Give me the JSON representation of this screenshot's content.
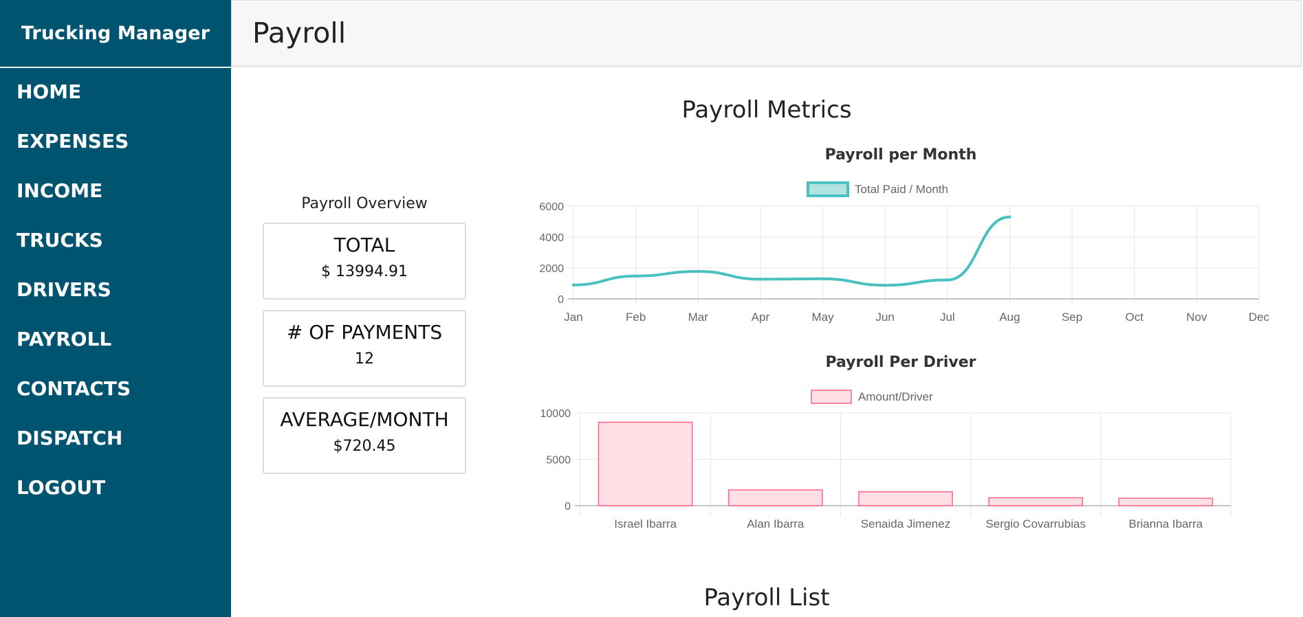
{
  "app": {
    "brand": "Trucking Manager"
  },
  "nav": {
    "items": [
      {
        "label": "HOME"
      },
      {
        "label": "EXPENSES"
      },
      {
        "label": "INCOME"
      },
      {
        "label": "TRUCKS"
      },
      {
        "label": "DRIVERS"
      },
      {
        "label": "PAYROLL"
      },
      {
        "label": "CONTACTS"
      },
      {
        "label": "DISPATCH"
      },
      {
        "label": "LOGOUT"
      }
    ]
  },
  "header": {
    "title": "Payroll"
  },
  "metrics": {
    "title": "Payroll Metrics"
  },
  "overview": {
    "title": "Payroll Overview",
    "cards": [
      {
        "label": "TOTAL",
        "value": "$ 13994.91"
      },
      {
        "label": "# OF PAYMENTS",
        "value": "12"
      },
      {
        "label": "AVERAGE/MONTH",
        "value": "$720.45"
      }
    ]
  },
  "list": {
    "title": "Payroll List"
  },
  "chart_data": [
    {
      "type": "line",
      "title": "Payroll per Month",
      "categories": [
        "Jan",
        "Feb",
        "Mar",
        "Apr",
        "May",
        "Jun",
        "Jul",
        "Aug",
        "Sep",
        "Oct",
        "Nov",
        "Dec"
      ],
      "series": [
        {
          "name": "Total Paid / Month",
          "values": [
            900,
            1480,
            1780,
            1270,
            1300,
            880,
            1220,
            5300,
            null,
            null,
            null,
            null
          ]
        }
      ],
      "ylim": [
        0,
        6000
      ],
      "yticks": [
        0,
        2000,
        4000,
        6000
      ],
      "xlabel": "",
      "ylabel": "",
      "grid": true,
      "legend": "top",
      "colors": {
        "line": "#4bc0c0",
        "legend_fill": "#b2e3e3"
      }
    },
    {
      "type": "bar",
      "title": "Payroll Per Driver",
      "categories": [
        "Israel Ibarra",
        "Alan Ibarra",
        "Senaida Jimenez",
        "Sergio Covarrubias",
        "Brianna Ibarra"
      ],
      "series": [
        {
          "name": "Amount/Driver",
          "values": [
            9000,
            1700,
            1500,
            850,
            800
          ]
        }
      ],
      "ylim": [
        0,
        10000
      ],
      "yticks": [
        0,
        5000,
        10000
      ],
      "xlabel": "",
      "ylabel": "",
      "grid": true,
      "legend": "top",
      "colors": {
        "bar_fill": "#ffe0e6",
        "bar_border": "#ff6384"
      }
    }
  ]
}
